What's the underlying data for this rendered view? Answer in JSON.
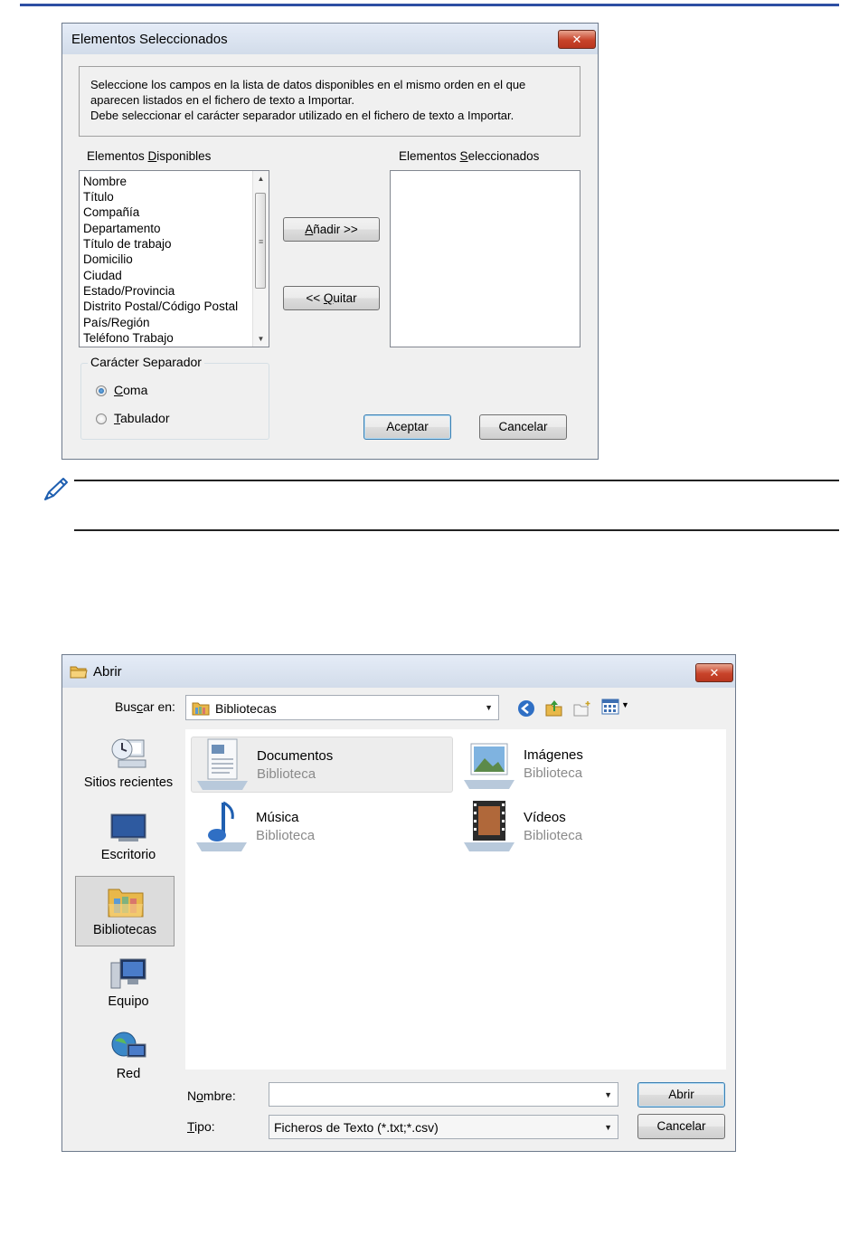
{
  "dialog1": {
    "title": "Elementos Seleccionados",
    "instructions": [
      "Seleccione los campos en la lista de datos disponibles en el mismo orden en el que",
      "aparecen listados en el fichero de texto a Importar.",
      "Debe seleccionar el carácter separador utilizado en el fichero de texto a Importar."
    ],
    "available_label": {
      "before": "Elementos ",
      "accel": "D",
      "after": "isponibles"
    },
    "selected_label": {
      "before": "Elementos ",
      "accel": "S",
      "after": "eleccionados"
    },
    "available_items": [
      "Nombre",
      "Título",
      "Compañía",
      "Departamento",
      "Título de trabajo",
      "Domicilio",
      "Ciudad",
      "Estado/Provincia",
      "Distrito Postal/Código Postal",
      "País/Región",
      "Teléfono Trabajo"
    ],
    "selected_items": [],
    "add_button": {
      "accel": "A",
      "after": "ñadir >>"
    },
    "remove_button": {
      "before": "<< ",
      "accel": "Q",
      "after": "uitar"
    },
    "separator_group": "Carácter Separador",
    "separator_options": [
      {
        "accel": "C",
        "after": "oma",
        "selected": true
      },
      {
        "accel": "T",
        "after": "abulador",
        "selected": false
      }
    ],
    "ok_button": "Aceptar",
    "cancel_button": "Cancelar"
  },
  "dialog2": {
    "title": "Abrir",
    "look_in_label": {
      "before": "Bus",
      "accel": "c",
      "after": "ar en:"
    },
    "look_in_value": "Bibliotecas",
    "places": [
      "Sitios recientes",
      "Escritorio",
      "Bibliotecas",
      "Equipo",
      "Red"
    ],
    "selected_place": "Bibliotecas",
    "libraries": [
      {
        "name": "Documentos",
        "type": "Biblioteca",
        "icon": "documents-library-icon"
      },
      {
        "name": "Imágenes",
        "type": "Biblioteca",
        "icon": "pictures-library-icon"
      },
      {
        "name": "Música",
        "type": "Biblioteca",
        "icon": "music-library-icon"
      },
      {
        "name": "Vídeos",
        "type": "Biblioteca",
        "icon": "videos-library-icon"
      }
    ],
    "filename_label": {
      "before": "N",
      "accel": "o",
      "after": "mbre:"
    },
    "filename_value": "",
    "type_label": {
      "accel": "T",
      "after": "ipo:"
    },
    "type_value": "Ficheros de Texto (*.txt;*.csv)",
    "open_button": "Abrir",
    "cancel_button": "Cancelar"
  },
  "colors": {
    "accent_rule": "#2d4fa3",
    "close_button": "#c8432a",
    "dialog_bg": "#f0f0f0",
    "secondary_text": "#8a8a8a"
  }
}
